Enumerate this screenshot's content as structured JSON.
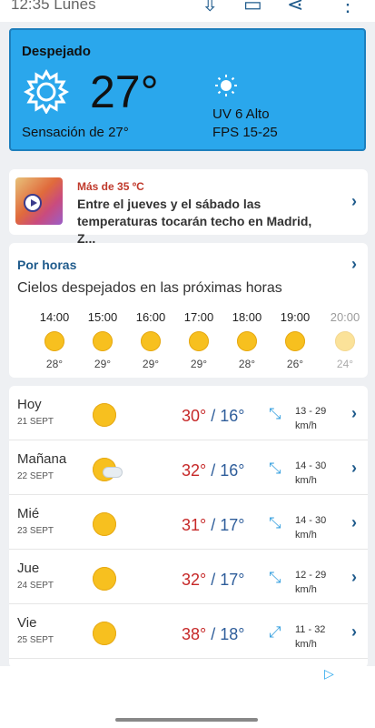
{
  "status": {
    "time": "12:35 Lunes"
  },
  "current": {
    "condition": "Despejado",
    "temperature": "27°",
    "feels_like": "Sensación de 27°",
    "uv": "UV 6 Alto",
    "fps": "FPS 15-25"
  },
  "news": {
    "tag": "Más de 35 ºC",
    "headline": "Entre el jueves y el sábado las temperaturas tocarán techo en Madrid, Z..."
  },
  "hourly": {
    "title": "Por horas",
    "summary": "Cielos despejados en las próximas horas",
    "hours": [
      {
        "time": "14:00",
        "temp": "28°"
      },
      {
        "time": "15:00",
        "temp": "29°"
      },
      {
        "time": "16:00",
        "temp": "29°"
      },
      {
        "time": "17:00",
        "temp": "29°"
      },
      {
        "time": "18:00",
        "temp": "28°"
      },
      {
        "time": "19:00",
        "temp": "26°"
      },
      {
        "time": "20:00",
        "temp": "24°"
      }
    ]
  },
  "daily": [
    {
      "day": "Hoy",
      "date": "21 SEPT",
      "max": "30°",
      "min": "16°",
      "wind": "13 - 29",
      "unit": "km/h"
    },
    {
      "day": "Mañana",
      "date": "22 SEPT",
      "max": "32°",
      "min": "16°",
      "wind": "14 - 30",
      "unit": "km/h"
    },
    {
      "day": "Mié",
      "date": "23 SEPT",
      "max": "31°",
      "min": "17°",
      "wind": "14 - 30",
      "unit": "km/h"
    },
    {
      "day": "Jue",
      "date": "24 SEPT",
      "max": "32°",
      "min": "17°",
      "wind": "12 - 29",
      "unit": "km/h"
    },
    {
      "day": "Vie",
      "date": "25 SEPT",
      "max": "38°",
      "min": "18°",
      "wind": "11 - 32",
      "unit": "km/h"
    }
  ],
  "colors": {
    "current_bg": "#2aa7ec",
    "accent": "#1f5b8c",
    "max_temp": "#c62828",
    "min_temp": "#2e5d9a"
  }
}
